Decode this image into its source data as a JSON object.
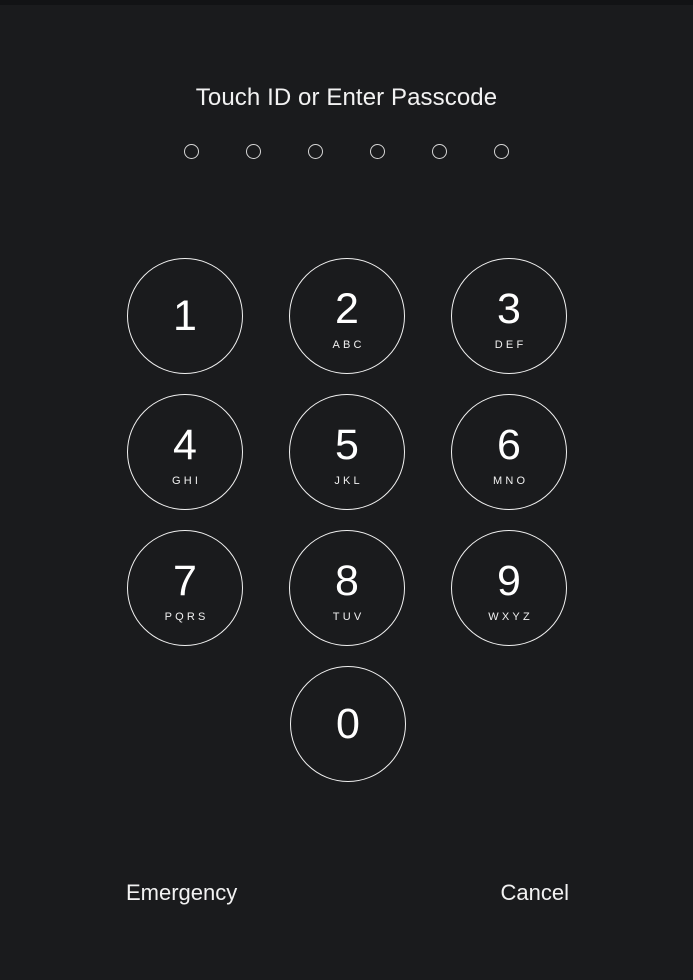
{
  "screen": {
    "name": "lock-screen-passcode",
    "background_color": "#1a1b1d",
    "title": "Touch ID or Enter Passcode"
  },
  "passcode": {
    "length": 6,
    "entered_count": 0,
    "dots": [
      {
        "filled": false
      },
      {
        "filled": false
      },
      {
        "filled": false
      },
      {
        "filled": false
      },
      {
        "filled": false
      },
      {
        "filled": false
      }
    ],
    "dot_color": "#d6d6d6"
  },
  "keypad": {
    "key_color": "#f0f0f0",
    "rows": [
      [
        {
          "digit": "1",
          "letters": ""
        },
        {
          "digit": "2",
          "letters": "ABC"
        },
        {
          "digit": "3",
          "letters": "DEF"
        }
      ],
      [
        {
          "digit": "4",
          "letters": "GHI"
        },
        {
          "digit": "5",
          "letters": "JKL"
        },
        {
          "digit": "6",
          "letters": "MNO"
        }
      ],
      [
        {
          "digit": "7",
          "letters": "PQRS"
        },
        {
          "digit": "8",
          "letters": "TUV"
        },
        {
          "digit": "9",
          "letters": "WXYZ"
        }
      ],
      [
        {
          "digit": "0",
          "letters": ""
        }
      ]
    ]
  },
  "actions": {
    "emergency_label": "Emergency",
    "cancel_label": "Cancel"
  }
}
